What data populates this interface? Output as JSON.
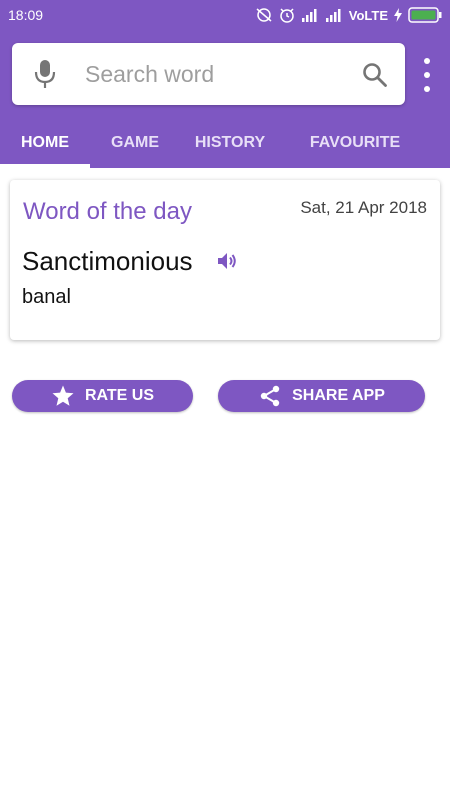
{
  "status_bar": {
    "time": "18:09",
    "network": "VoLTE"
  },
  "search": {
    "placeholder": "Search word",
    "value": ""
  },
  "tabs": [
    {
      "label": "HOME",
      "active": true
    },
    {
      "label": "GAME",
      "active": false
    },
    {
      "label": "HISTORY",
      "active": false
    },
    {
      "label": "FAVOURITE",
      "active": false
    }
  ],
  "word_of_day": {
    "title": "Word of the day",
    "date": "Sat, 21 Apr 2018",
    "word": "Sanctimonious",
    "meaning": "banal"
  },
  "buttons": {
    "rate_us": "RATE US",
    "share_app": "SHARE APP"
  },
  "colors": {
    "primary": "#7e57c2",
    "battery": "#4caf50"
  },
  "icons": [
    "mic-icon",
    "search-icon",
    "more-vert-icon",
    "speaker-icon",
    "star-icon",
    "share-icon"
  ]
}
